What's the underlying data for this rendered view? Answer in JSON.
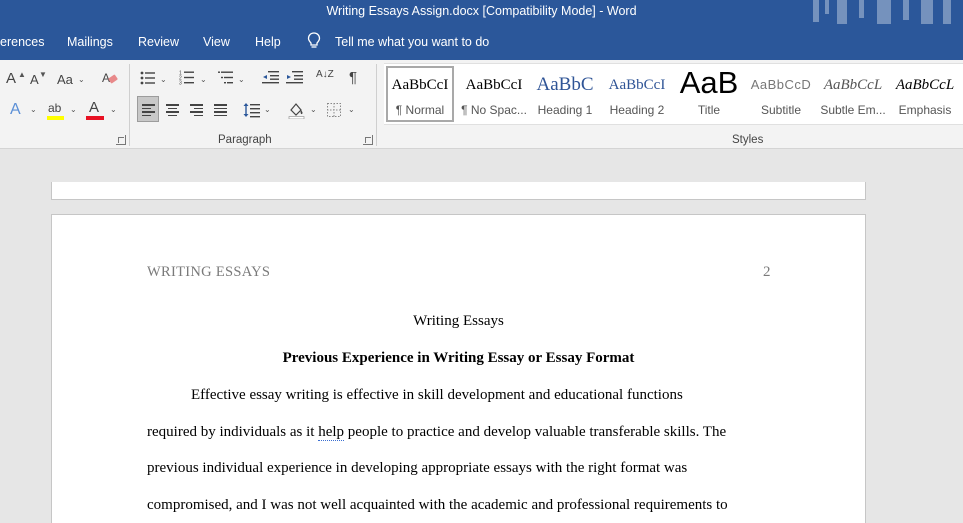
{
  "window": {
    "title": "Writing Essays Assign.docx [Compatibility Mode]  -  Word"
  },
  "menu": {
    "tabs": [
      "erences",
      "Mailings",
      "Review",
      "View",
      "Help"
    ],
    "tell_me": "Tell me what you want to do"
  },
  "ribbon": {
    "font": {
      "grow_label": "A",
      "shrink_label": "A",
      "change_case_label": "Aa",
      "text_effects_label": "A",
      "highlight_label": "ab",
      "font_color_label": "A",
      "highlight_color": "#ffff00",
      "font_color": "#e81123"
    },
    "paragraph": {
      "label": "Paragraph",
      "sort_label": "A↓Z",
      "pilcrow": "¶"
    },
    "styles": {
      "label": "Styles",
      "items": [
        {
          "preview": "AaBbCcI",
          "name": "¶ Normal"
        },
        {
          "preview": "AaBbCcI",
          "name": "¶ No Spac..."
        },
        {
          "preview": "AaBbC",
          "name": "Heading 1"
        },
        {
          "preview": "AaBbCcI",
          "name": "Heading 2"
        },
        {
          "preview": "AaB",
          "name": "Title"
        },
        {
          "preview": "AaBbCcD",
          "name": "Subtitle"
        },
        {
          "preview": "AaBbCcL",
          "name": "Subtle Em..."
        },
        {
          "preview": "AaBbCcL",
          "name": "Emphasis"
        }
      ]
    }
  },
  "document": {
    "running_head": "WRITING ESSAYS",
    "page_number": "2",
    "title": "Writing Essays",
    "heading": "Previous Experience in Writing Essay or Essay Format",
    "lines": [
      "Effective essay writing is effective in skill development and educational functions",
      "people to practice and develop valuable transferable skills. The",
      "previous individual experience in developing appropriate essays with the right format was",
      "compromised, and I was not well acquainted with the academic and professional requirements to"
    ],
    "line2_prefix": "required by individuals as it ",
    "line2_flagged": "help"
  }
}
